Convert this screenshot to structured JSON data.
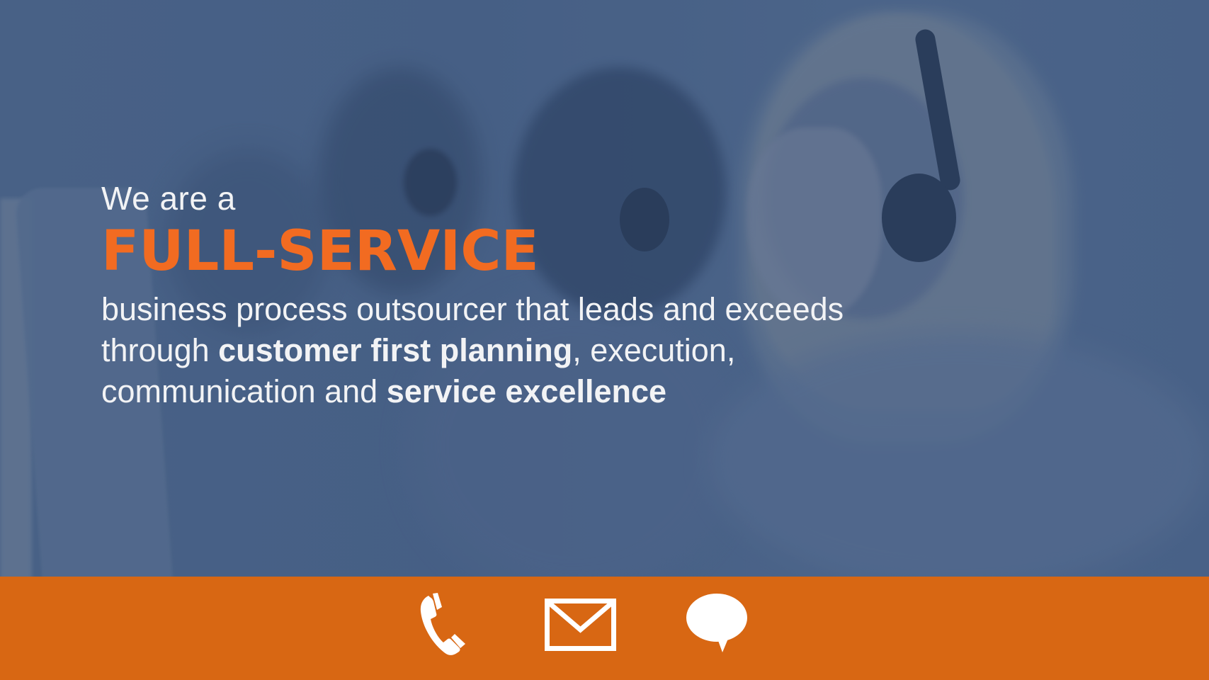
{
  "hero": {
    "intro": "We are a",
    "headline": "FULL-SERVICE",
    "line1": "business process outsourcer that leads and exceeds",
    "line2_prefix": "through ",
    "line2_bold": "customer first planning",
    "line2_suffix": ", execution,",
    "line3_prefix": "communication and ",
    "line3_bold": "service excellence"
  },
  "footer": {
    "icons": [
      "phone-icon",
      "mail-icon",
      "chat-icon"
    ]
  },
  "colors": {
    "accent_orange": "#f26b21",
    "footer_orange": "#d86713",
    "overlay_blue": "#4a6287",
    "text": "#f2f3f5"
  }
}
